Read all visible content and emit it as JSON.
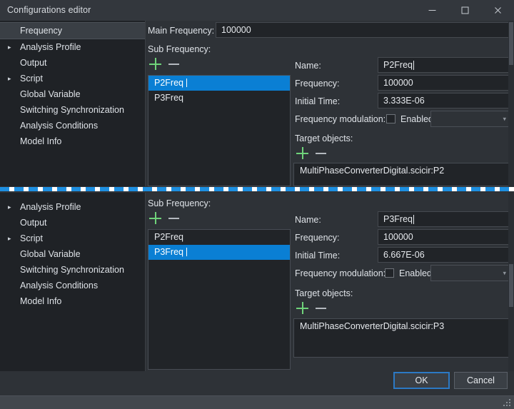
{
  "window": {
    "title": "Configurations editor",
    "controls": [
      {
        "name": "minimize",
        "glyph": "minimize-icon"
      },
      {
        "name": "maximize",
        "glyph": "maximize-icon"
      },
      {
        "name": "close",
        "glyph": "close-icon"
      }
    ]
  },
  "colors": {
    "selection_blue": "#0a7fd4",
    "plus_green": "#6fd37a",
    "minus_gray": "#b4b9bf",
    "panel_bg": "#2e3237",
    "field_bg": "#212428",
    "sidebar_bg": "#1f2226",
    "focus_border": "#2c79c4",
    "stitch_blue": "#1e8fe0"
  },
  "top_pane": {
    "sidebar": {
      "items": [
        {
          "label": "Frequency",
          "expandable": false,
          "selected": true
        },
        {
          "label": "Analysis Profile",
          "expandable": true,
          "selected": false
        },
        {
          "label": "Output",
          "expandable": false,
          "selected": false
        },
        {
          "label": "Script",
          "expandable": true,
          "selected": false
        },
        {
          "label": "Global Variable",
          "expandable": false,
          "selected": false
        },
        {
          "label": "Switching Synchronization",
          "expandable": false,
          "selected": false
        },
        {
          "label": "Analysis Conditions",
          "expandable": false,
          "selected": false
        },
        {
          "label": "Model Info",
          "expandable": false,
          "selected": false
        }
      ]
    },
    "main_frequency": {
      "label": "Main Frequency:",
      "value": "100000"
    },
    "sub_frequency": {
      "label": "Sub Frequency:",
      "add_label": "+",
      "remove_label": "–",
      "items": [
        {
          "label": "P2Freq",
          "selected": true
        },
        {
          "label": "P3Freq",
          "selected": false
        }
      ]
    },
    "details": {
      "name": {
        "label": "Name:",
        "value": "P2Freq"
      },
      "frequency": {
        "label": "Frequency:",
        "value": "100000"
      },
      "initial_time": {
        "label": "Initial Time:",
        "value": "3.333E-06"
      },
      "frequency_modulation": {
        "label": "Frequency modulation:",
        "checkbox_label": "Enabled",
        "checked": false,
        "dropdown_value": ""
      },
      "target_objects": {
        "label": "Target objects:",
        "add_label": "+",
        "remove_label": "–",
        "items": [
          "MultiPhaseConverterDigital.scicir:P2"
        ]
      }
    }
  },
  "bottom_pane": {
    "sidebar": {
      "items": [
        {
          "label": "Analysis Profile",
          "expandable": true,
          "selected": false
        },
        {
          "label": "Output",
          "expandable": false,
          "selected": false
        },
        {
          "label": "Script",
          "expandable": true,
          "selected": false
        },
        {
          "label": "Global Variable",
          "expandable": false,
          "selected": false
        },
        {
          "label": "Switching Synchronization",
          "expandable": false,
          "selected": false
        },
        {
          "label": "Analysis Conditions",
          "expandable": false,
          "selected": false
        },
        {
          "label": "Model Info",
          "expandable": false,
          "selected": false
        }
      ]
    },
    "sub_frequency": {
      "label": "Sub Frequency:",
      "add_label": "+",
      "remove_label": "–",
      "items": [
        {
          "label": "P2Freq",
          "selected": false
        },
        {
          "label": "P3Freq",
          "selected": true
        }
      ]
    },
    "details": {
      "name": {
        "label": "Name:",
        "value": "P3Freq"
      },
      "frequency": {
        "label": "Frequency:",
        "value": "100000"
      },
      "initial_time": {
        "label": "Initial Time:",
        "value": "6.667E-06"
      },
      "frequency_modulation": {
        "label": "Frequency modulation:",
        "checkbox_label": "Enabled",
        "checked": false,
        "dropdown_value": ""
      },
      "target_objects": {
        "label": "Target objects:",
        "add_label": "+",
        "remove_label": "–",
        "items": [
          "MultiPhaseConverterDigital.scicir:P3"
        ]
      }
    },
    "buttons": {
      "ok": "OK",
      "cancel": "Cancel"
    }
  }
}
